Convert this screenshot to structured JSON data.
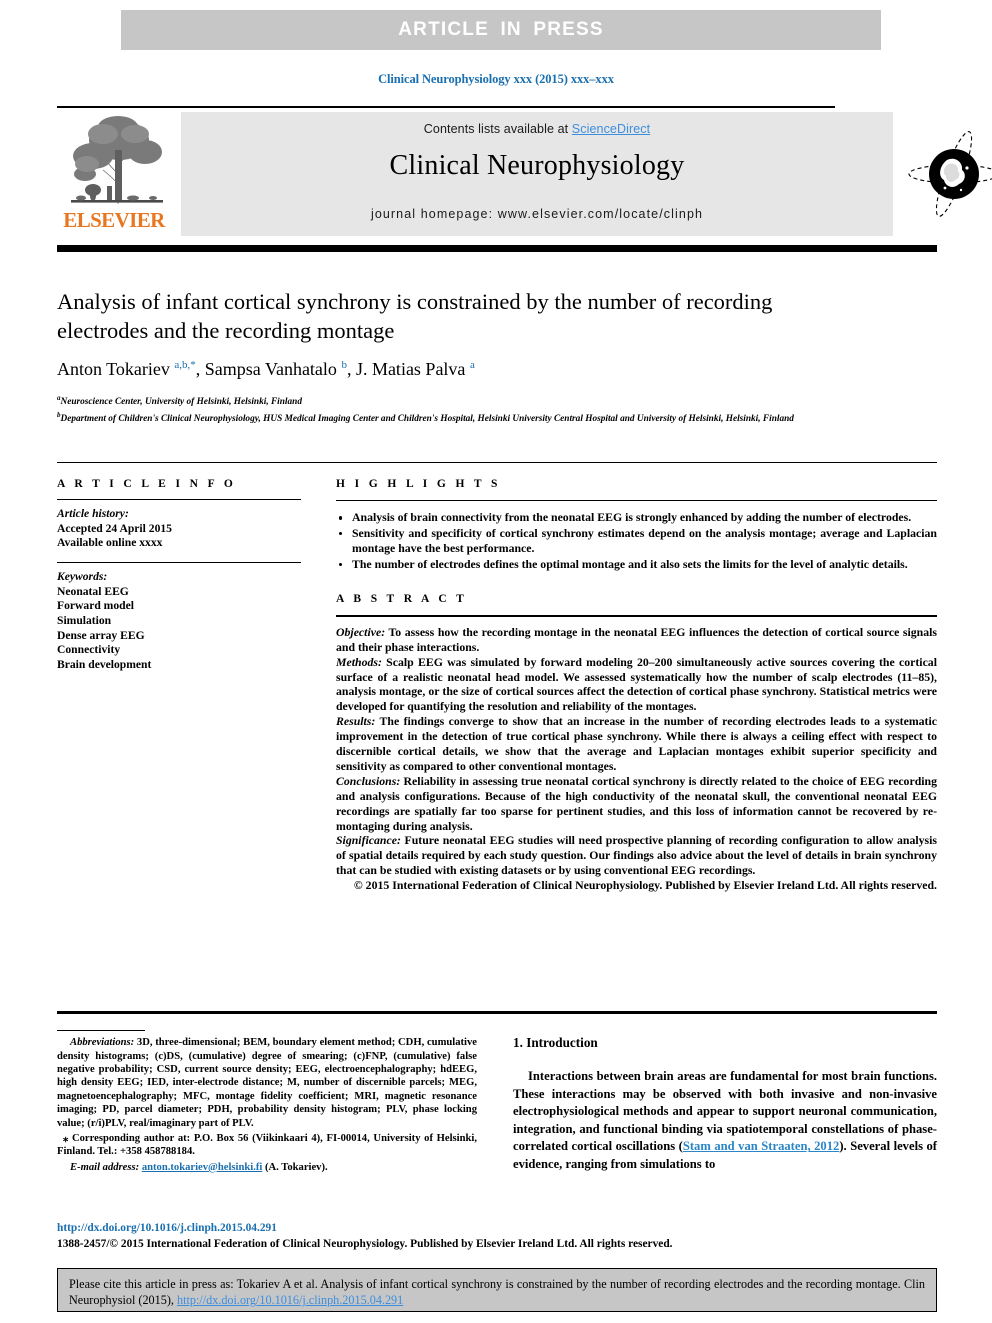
{
  "banner": {
    "text": "ARTICLE  IN  PRESS"
  },
  "running_head": "Clinical Neurophysiology xxx (2015) xxx–xxx",
  "masthead": {
    "contents_prefix": "Contents lists available at ",
    "sciencedirect": "ScienceDirect",
    "journal_name": "Clinical Neurophysiology",
    "homepage": "journal homepage: www.elsevier.com/locate/clinph",
    "publisher_logo_text": "ELSEVIER",
    "publisher_logo_color": "#e87722",
    "link_color": "#3e8ede"
  },
  "article": {
    "title": "Analysis of infant cortical synchrony is constrained by the number of recording electrodes and the recording montage",
    "authors_html": "Anton Tokariev <sup>a,b,*</sup>, Sampsa Vanhatalo <sup>b</sup>, J. Matias Palva <sup>a</sup>",
    "affiliations": [
      {
        "marker": "a",
        "text": "Neuroscience Center, University of Helsinki, Helsinki, Finland"
      },
      {
        "marker": "b",
        "text": "Department of Children's Clinical Neurophysiology, HUS Medical Imaging Center and Children's Hospital, Helsinki University Central Hospital and University of Helsinki, Helsinki, Finland"
      }
    ]
  },
  "article_info": {
    "heading": "A R T I C L E   I N F O",
    "history_label": "Article history:",
    "history": [
      "Accepted 24 April 2015",
      "Available online xxxx"
    ],
    "keywords_label": "Keywords:",
    "keywords": [
      "Neonatal EEG",
      "Forward model",
      "Simulation",
      "Dense array EEG",
      "Connectivity",
      "Brain development"
    ]
  },
  "highlights": {
    "heading": "H I G H L I G H T S",
    "items": [
      "Analysis of brain connectivity from the neonatal EEG is strongly enhanced by adding the number of electrodes.",
      "Sensitivity and specificity of cortical synchrony estimates depend on the analysis montage; average and Laplacian montage have the best performance.",
      "The number of electrodes defines the optimal montage and it also sets the limits for the level of analytic details."
    ]
  },
  "abstract": {
    "heading": "A B S T R A C T",
    "sections": [
      {
        "label": "Objective:",
        "text": " To assess how the recording montage in the neonatal EEG influences the detection of cortical source signals and their phase interactions."
      },
      {
        "label": "Methods:",
        "text": " Scalp EEG was simulated by forward modeling 20–200 simultaneously active sources covering the cortical surface of a realistic neonatal head model. We assessed systematically how the number of scalp electrodes (11–85), analysis montage, or the size of cortical sources affect the detection of cortical phase synchrony. Statistical metrics were developed for quantifying the resolution and reliability of the montages."
      },
      {
        "label": "Results:",
        "text": " The findings converge to show that an increase in the number of recording electrodes leads to a systematic improvement in the detection of true cortical phase synchrony. While there is always a ceiling effect with respect to discernible cortical details, we show that the average and Laplacian montages exhibit superior specificity and sensitivity as compared to other conventional montages."
      },
      {
        "label": "Conclusions:",
        "text": " Reliability in assessing true neonatal cortical synchrony is directly related to the choice of EEG recording and analysis configurations. Because of the high conductivity of the neonatal skull, the conventional neonatal EEG recordings are spatially far too sparse for pertinent studies, and this loss of information cannot be recovered by re-montaging during analysis."
      },
      {
        "label": "Significance:",
        "text": " Future neonatal EEG studies will need prospective planning of recording configuration to allow analysis of spatial details required by each study question. Our findings also advice about the level of details in brain synchrony that can be studied with existing datasets or by using conventional EEG recordings."
      }
    ],
    "copyright": "© 2015 International Federation of Clinical Neurophysiology. Published by Elsevier Ireland Ltd. All rights reserved."
  },
  "footnotes": {
    "abbreviations_label": "Abbreviations:",
    "abbreviations_text": " 3D, three-dimensional; BEM, boundary element method; CDH, cumulative density histograms; (c)DS, (cumulative) degree of smearing; (c)FNP, (cumulative) false negative probability; CSD, current source density; EEG, electroencephalography; hdEEG, high density EEG; IED, inter-electrode distance; M, number of discernible parcels; MEG, magnetoencephalography; MFC, montage fidelity coefficient; MRI, magnetic resonance imaging; PD, parcel diameter; PDH, probability density histogram; PLV, phase locking value; (r/i)PLV, real/imaginary part of PLV.",
    "corresponding_marker": "⁎",
    "corresponding_text": " Corresponding author at: P.O. Box 56 (Viikinkaari 4), FI-00014, University of Helsinki, Finland. Tel.: +358 458788184.",
    "email_label": "E-mail address:",
    "email": "anton.tokariev@helsinki.fi",
    "email_suffix": " (A. Tokariev)."
  },
  "introduction": {
    "heading": "1. Introduction",
    "paragraph_before": "Interactions between brain areas are fundamental for most brain functions. These interactions may be observed with both invasive and non-invasive electrophysiological methods and appear to support neuronal communication, integration, and functional binding via spatiotemporal constellations of phase-correlated cortical oscillations (",
    "citation": "Stam and van Straaten, 2012",
    "paragraph_after": "). Several levels of evidence, ranging from simulations to"
  },
  "footer": {
    "doi": "http://dx.doi.org/10.1016/j.clinph.2015.04.291",
    "issn": "1388-2457/© 2015 International Federation of Clinical Neurophysiology. Published by Elsevier Ireland Ltd. All rights reserved.",
    "cite_prefix": "Please cite this article in press as: Tokariev A et al. Analysis of infant cortical synchrony is constrained by the number of recording electrodes and the recording montage. Clin Neurophysiol (2015), ",
    "cite_link": "http://dx.doi.org/10.1016/j.clinph.2015.04.291"
  }
}
